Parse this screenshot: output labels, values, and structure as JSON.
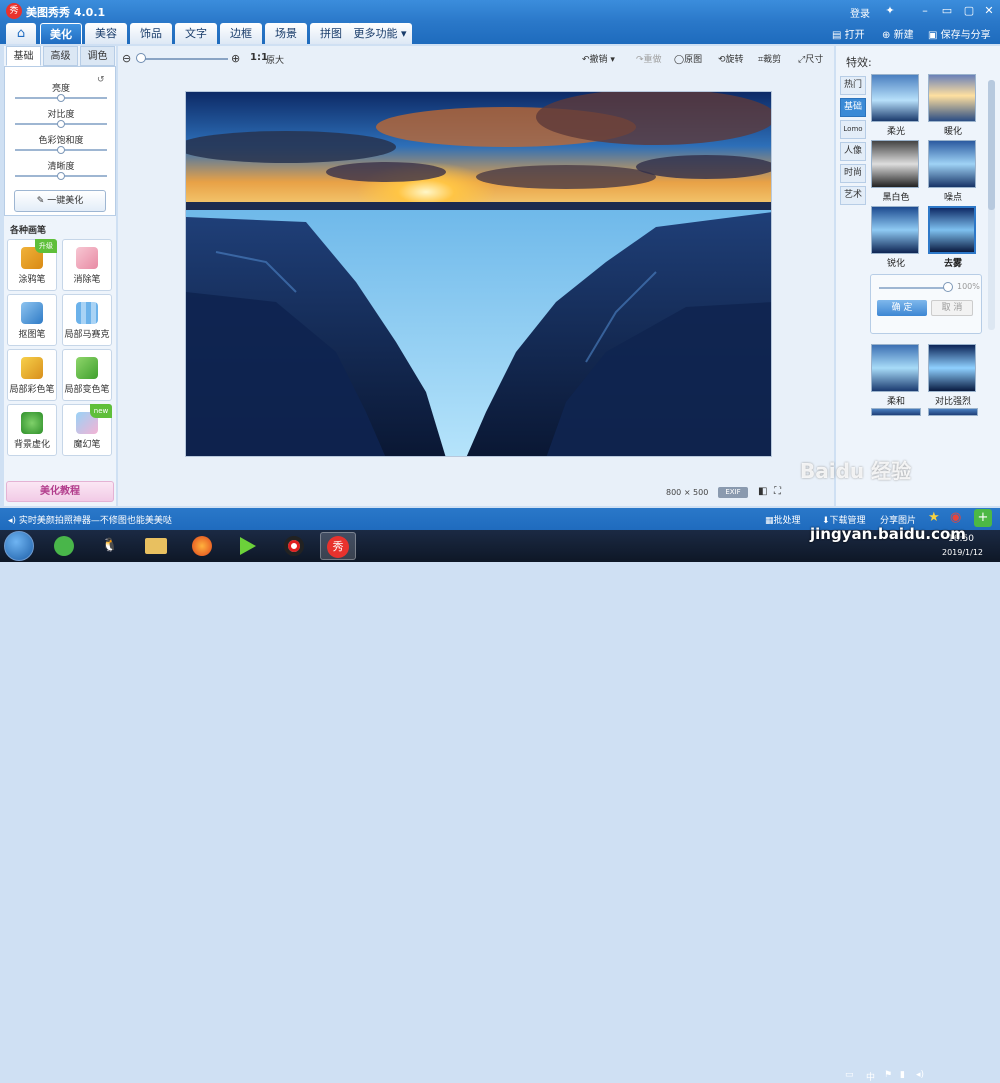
{
  "app": {
    "title": "美图秀秀 4.0.1",
    "logo": "秀"
  },
  "titlebar": {
    "login": "登录"
  },
  "menu": {
    "home_icon": "home-icon",
    "tabs": [
      "美化",
      "美容",
      "饰品",
      "文字",
      "边框",
      "场景",
      "拼图",
      "更多功能 ▾"
    ]
  },
  "header_actions": {
    "open": "打开",
    "new": "新建",
    "save_share": "保存与分享"
  },
  "left_panel": {
    "tabs": [
      "基础",
      "高级",
      "调色"
    ],
    "sliders": [
      {
        "label": "亮度",
        "value": 0.5
      },
      {
        "label": "对比度",
        "value": 0.5
      },
      {
        "label": "色彩饱和度",
        "value": 0.5
      },
      {
        "label": "清晰度",
        "value": 0.5
      }
    ],
    "one_click": "一键美化",
    "pens_title": "各种画笔",
    "pens": [
      {
        "label": "涂鸦笔",
        "badge": "升级"
      },
      {
        "label": "消除笔",
        "badge": ""
      },
      {
        "label": "抠图笔",
        "badge": ""
      },
      {
        "label": "局部马赛克",
        "badge": ""
      },
      {
        "label": "局部彩色笔",
        "badge": ""
      },
      {
        "label": "局部变色笔",
        "badge": ""
      },
      {
        "label": "背景虚化",
        "badge": ""
      },
      {
        "label": "魔幻笔",
        "badge": "new"
      }
    ],
    "tutorial": "美化教程"
  },
  "toolbar": {
    "zoom_11": "1:1",
    "zoom_orig": "原大",
    "undo": "撤销",
    "redo": "重做",
    "original": "原图",
    "rotate": "旋转",
    "crop": "裁剪",
    "resize": "尺寸"
  },
  "image_info": {
    "size": "800 × 500",
    "exif": "EXIF"
  },
  "right_panel": {
    "title": "特效:",
    "categories": [
      "热门",
      "基础",
      "Lomo",
      "人像",
      "时尚",
      "艺术"
    ],
    "active_category": "基础",
    "effects": [
      "柔光",
      "暖化",
      "黑白色",
      "噪点",
      "锐化",
      "去雾",
      "柔和",
      "对比强烈"
    ],
    "selected_effect": "去雾",
    "popup": {
      "value_text": "100%",
      "ok": "确 定",
      "cancel": "取 消",
      "level": 1.0
    }
  },
  "statusbar": {
    "text": "实时美颜拍照神器—不修图也能美美哒",
    "batch": "批处理",
    "downloads": "下载管理",
    "share": "分享图片"
  },
  "taskbar": {
    "time": "16:50",
    "date": "2019/1/12",
    "tray_lang": "中"
  },
  "watermark": {
    "text": "Baidu 经验",
    "url": "jingyan.baidu.com"
  },
  "colors": {
    "accent": "#2a78c9",
    "selected": "#2d78c8"
  }
}
